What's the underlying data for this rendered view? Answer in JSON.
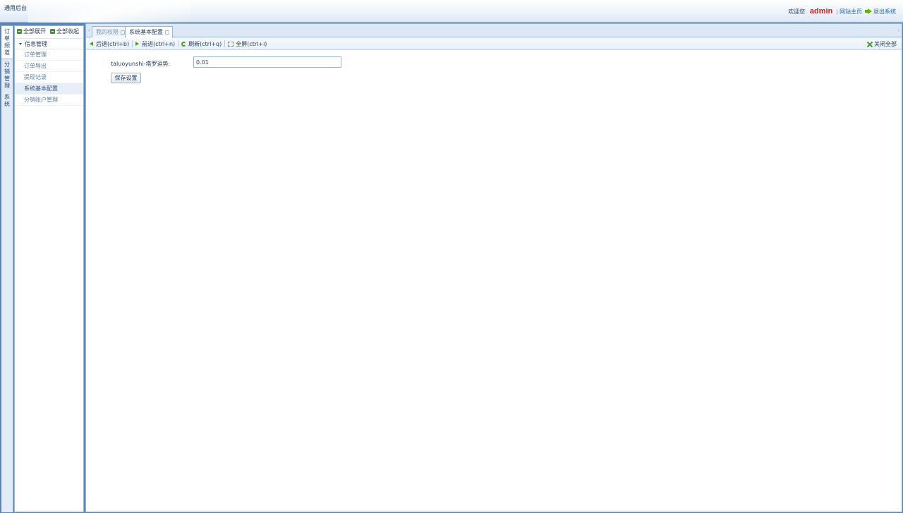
{
  "header": {
    "app_title": "通用后台",
    "welcome": "欢迎您:",
    "username": "admin",
    "separator": "|",
    "site_home": "网站主页",
    "logout": "退出系统"
  },
  "channels": [
    {
      "label": "订单频道",
      "active": true
    },
    {
      "label": "分销管理",
      "active": false
    },
    {
      "label": "系统",
      "active": false
    }
  ],
  "tree": {
    "expand_all": "全部展开",
    "collapse_all": "全部收起",
    "group": "信息管理",
    "items": [
      "订单管理",
      "订单导出",
      "提现记录",
      "系统基本配置",
      "分销账户管理"
    ],
    "selected": "系统基本配置"
  },
  "tabs": [
    {
      "label": "我的权限",
      "active": false
    },
    {
      "label": "系统基本配置",
      "active": true
    }
  ],
  "toolbar": {
    "back": "后退(ctrl+b)",
    "forward": "前进(ctrl+n)",
    "refresh": "刷新(ctrl+q)",
    "fullscreen": "全屏(ctrl+i)",
    "close_all": "关闭全部"
  },
  "form": {
    "label": "taluoyunshi-塔罗运势:",
    "value": "0.01",
    "save": "保存设置"
  },
  "colors": {
    "accent": "#5a86b4",
    "username": "#d31c1c",
    "icon_green": "#4aa31c"
  }
}
